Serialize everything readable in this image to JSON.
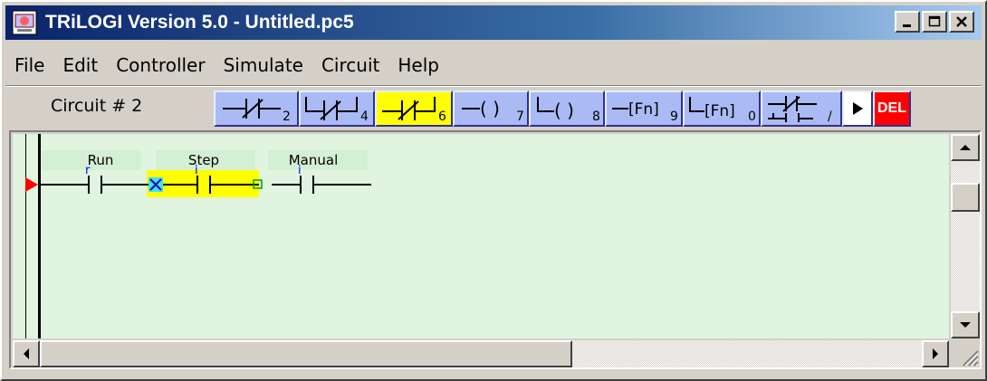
{
  "window": {
    "title": "TRiLOGI Version 5.0 - Untitled.pc5",
    "controls": {
      "minimize": "_",
      "maximize": "□",
      "close": "X"
    }
  },
  "menu": {
    "items": [
      "File",
      "Edit",
      "Controller",
      "Simulate",
      "Circuit",
      "Help"
    ]
  },
  "toolbar": {
    "circuit_label": "Circuit # 2",
    "palette": [
      {
        "icon": "nc-contact-series-icon",
        "subscript": "2"
      },
      {
        "icon": "nc-contact-parallel-icon",
        "subscript": "4"
      },
      {
        "icon": "nc-contact-parallel-selected-icon",
        "subscript": "6",
        "active": true
      },
      {
        "icon": "coil-icon",
        "symbol": "( )",
        "subscript": "7"
      },
      {
        "icon": "parallel-coil-icon",
        "symbol": "( )",
        "subscript": "8"
      },
      {
        "icon": "function-icon",
        "symbol": "[Fn]",
        "subscript": "9"
      },
      {
        "icon": "parallel-function-icon",
        "symbol": "[Fn]",
        "subscript": "0"
      },
      {
        "icon": "branch-icon",
        "subscript": "/"
      },
      {
        "icon": "play-icon"
      },
      {
        "icon": "delete-icon",
        "label": "DEL"
      }
    ],
    "accent": "#ffff00",
    "palette_color": "#aabaf5",
    "del_color": "#ff0000"
  },
  "ladder": {
    "contacts": [
      {
        "label": "Run",
        "marker": "r"
      },
      {
        "label": "Step",
        "marker": "i",
        "selected": true
      },
      {
        "label": "Manual",
        "marker": "i"
      }
    ],
    "background": "#e0f4e0",
    "rung_marker_color": "#ff0000"
  }
}
